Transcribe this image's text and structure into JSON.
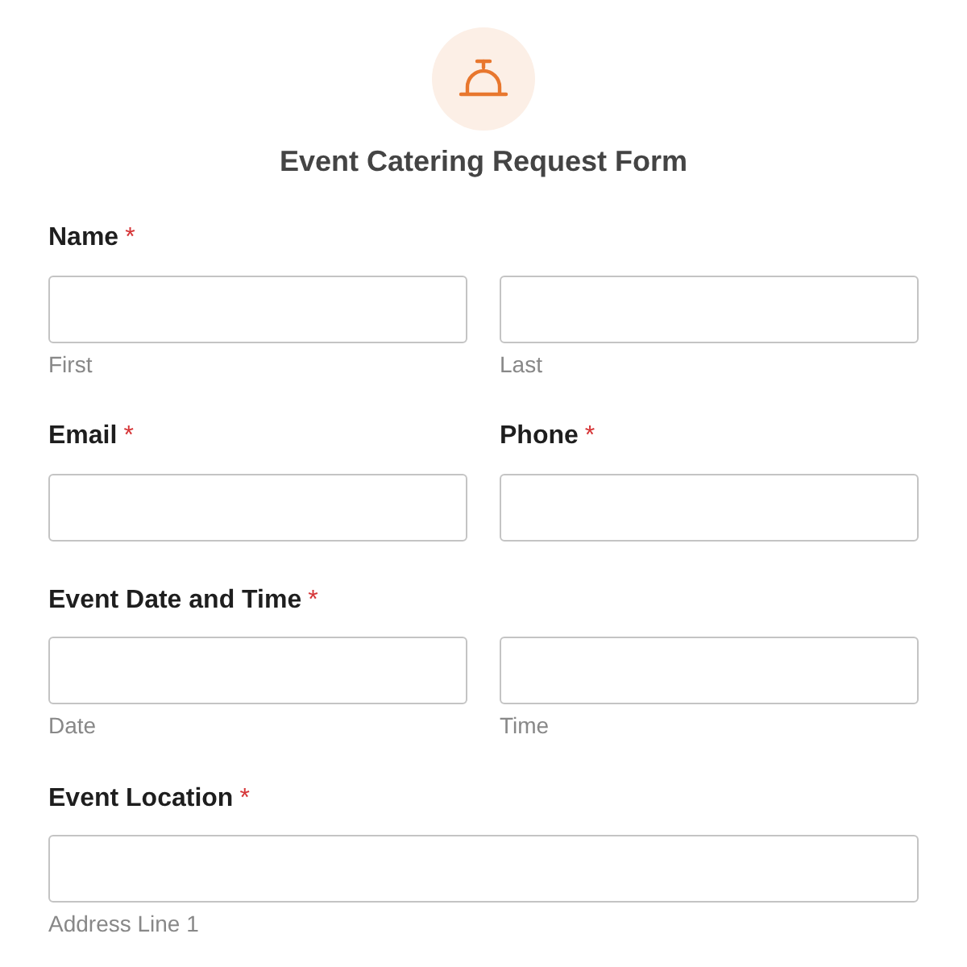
{
  "form": {
    "title": "Event Catering Request Form"
  },
  "rows": [
    {
      "fields": [
        {
          "label": "Name",
          "required_mark": "*",
          "sublabels": [
            "First",
            "Last"
          ]
        }
      ]
    },
    {
      "fields": [
        {
          "label": "Email",
          "required_mark": "*"
        },
        {
          "label": "Phone",
          "required_mark": "*"
        }
      ]
    },
    {
      "fields": [
        {
          "label": "Event Date and Time",
          "required_mark": "*",
          "sublabels": [
            "Date",
            "Time"
          ]
        }
      ]
    },
    {
      "fields": [
        {
          "label": "Event Location",
          "required_mark": "*",
          "sublabels": [
            "Address Line 1"
          ]
        }
      ]
    }
  ]
}
